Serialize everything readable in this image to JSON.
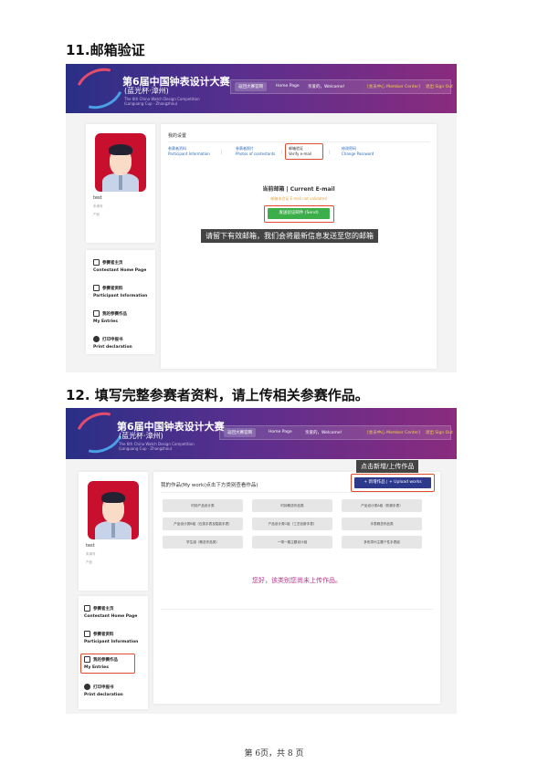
{
  "section1": {
    "heading": "11.邮箱验证",
    "banner": {
      "title": "第6届中国钟表设计大赛",
      "subtitle": "(蓝光杯·漳州)",
      "small1": "The 6th China Watch Design Competition",
      "small2": "(Languang Cup · Zhangzhou)",
      "nav_back": "返回大赛官网",
      "nav_home": "Home Page",
      "welcome": "亲爱的，Welcome!",
      "member_center": "[会员中心 Member Center]",
      "sign_out": "退出 Sign Out"
    },
    "profile": {
      "name": "test",
      "line1": "未填写",
      "line2": "产品"
    },
    "menu": [
      {
        "zh": "参赛者主页",
        "en": "Contestant Home Page"
      },
      {
        "zh": "参赛者资料",
        "en": "Participant Information"
      },
      {
        "zh": "我的参赛作品",
        "en": "My Entries"
      },
      {
        "zh": "打印申报书",
        "en": "Print declaration"
      }
    ],
    "panel": {
      "title": "我的设置",
      "tabs": [
        {
          "zh": "参赛者资料",
          "en": "Participant Information"
        },
        {
          "zh": "参赛者照片",
          "en": "Photos of contestants"
        },
        {
          "zh": "邮箱验证",
          "en": "Verify e-mail"
        },
        {
          "zh": "修改密码",
          "en": "Change Password"
        }
      ],
      "current_email_label": "当前邮箱 | Current E-mail",
      "not_validated": "邮箱未验证 E-mail not validated",
      "send_button": "发送验证邮件 (Send)",
      "tip": "请留下有效邮箱，我们会将最新信息发送至您的邮箱"
    }
  },
  "section2": {
    "heading": "12. 填写完整参赛者资料，请上传相关参赛作品。",
    "panel": {
      "title": "我的作品(My work(点击下方类别查看作品)",
      "add_button": "+ 新增作品 | + Upload works",
      "tip": "点击新增/上传作品",
      "categories": [
        "时钟产品设计类",
        "时钟概念作品类",
        "产品设计类A组（机械手表）",
        "产品设计类B组（石英手表及智能手表）",
        "产品设计类C组（工艺创新手表）",
        "手表概念作品类",
        "学生组（概念作品类）",
        "一带一路主题设计组",
        "多彩漳州主题个性手表组"
      ],
      "empty_msg": "您好，该类别您尚未上传作品。"
    }
  },
  "footer": "第 6页，共 8 页"
}
